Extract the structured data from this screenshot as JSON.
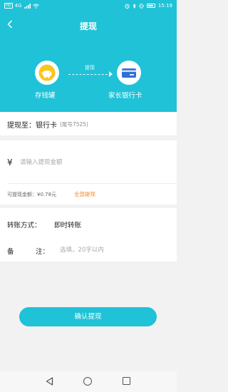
{
  "status_bar": {
    "left_badge": "HD",
    "signal": "4G",
    "time": "15:19"
  },
  "header": {
    "title": "提现",
    "back_icon": "chevron-left-icon"
  },
  "flow": {
    "source_label": "存钱罐",
    "arrow_label": "提现",
    "target_label": "家长银行卡",
    "source_icon": "piggy-bank-icon",
    "target_icon": "bank-card-icon"
  },
  "destination": {
    "label": "提现至：银行卡",
    "tail": "(尾号7525)"
  },
  "amount": {
    "currency_symbol": "¥",
    "placeholder": "请输入提现金额",
    "available_text": "可提现金额：¥0.78元",
    "withdraw_all_label": "全部提现"
  },
  "transfer": {
    "label": "转账方式：",
    "value": "即时转账"
  },
  "remark": {
    "label_first": "备",
    "label_second": "注：",
    "placeholder": "选填，20字以内"
  },
  "confirm_label": "确认提现",
  "colors": {
    "brand": "#1fc2d7",
    "accent_orange": "#f08a2c"
  }
}
